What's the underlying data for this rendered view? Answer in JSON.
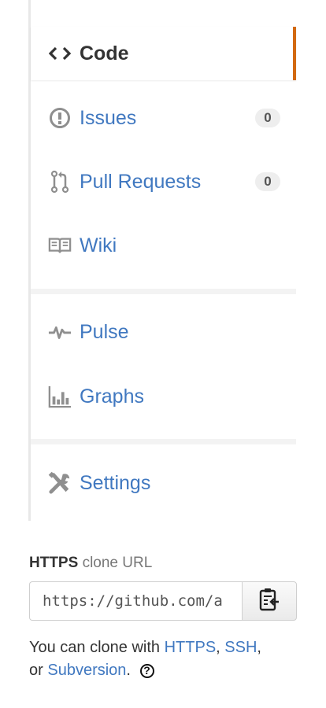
{
  "nav": {
    "code": {
      "label": "Code",
      "icon": "code-icon"
    },
    "issues": {
      "label": "Issues",
      "icon": "issue-opened-icon",
      "count": "0"
    },
    "pulls": {
      "label": "Pull Requests",
      "icon": "git-pull-request-icon",
      "count": "0"
    },
    "wiki": {
      "label": "Wiki",
      "icon": "book-icon"
    },
    "pulse": {
      "label": "Pulse",
      "icon": "pulse-icon"
    },
    "graphs": {
      "label": "Graphs",
      "icon": "graph-icon"
    },
    "settings": {
      "label": "Settings",
      "icon": "tools-icon"
    }
  },
  "clone": {
    "protocol": "HTTPS",
    "title_suffix": "clone URL",
    "url_value": "https://github.com/a",
    "help_prefix": "You can clone with",
    "link_https": "HTTPS",
    "link_ssh": "SSH",
    "help_or": "or",
    "link_svn": "Subversion",
    "help_end": ".",
    "help_icon": "?"
  },
  "colors": {
    "link": "#4078c0",
    "selected_accent": "#d26911",
    "icon_gray": "#8f8f8f",
    "counter_bg": "#eeeeee"
  }
}
